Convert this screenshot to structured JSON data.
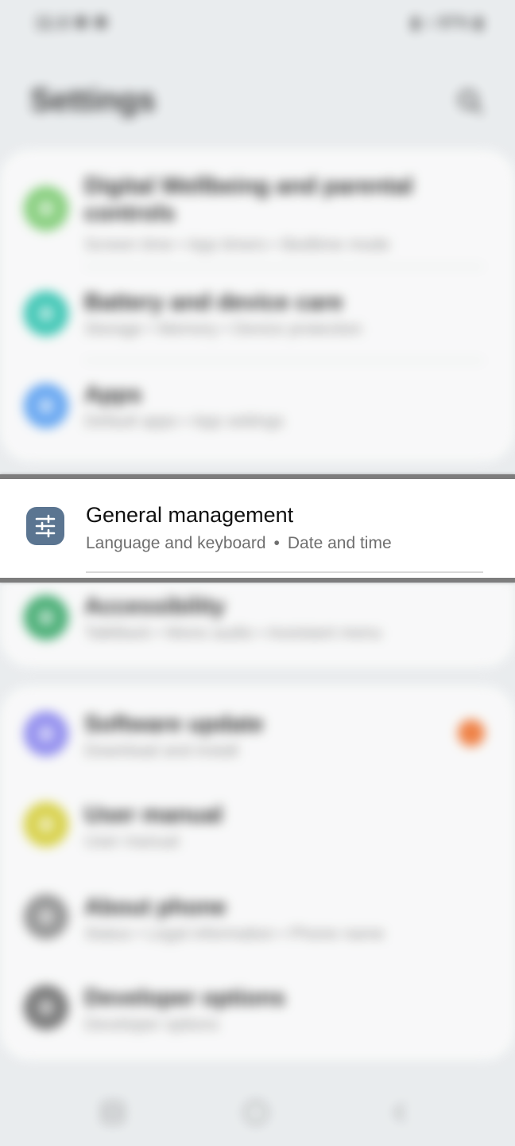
{
  "status": {
    "time": "11:0 ✱ ✱",
    "right": "▮ ◖ 97% ▮"
  },
  "header": {
    "title": "Settings"
  },
  "settings_items": [
    {
      "title": "Digital Wellbeing and parental",
      "title2": "controls",
      "subtitle": "Screen time • App timers • Bedtime mode",
      "color": "#7dcc72"
    },
    {
      "title": "Battery and device care",
      "subtitle": "Storage • Memory • Device protection",
      "color": "#2fc3b0"
    },
    {
      "title": "Apps",
      "subtitle": "Default apps • App settings",
      "color": "#5aa0f2"
    },
    {
      "title": "Accessibility",
      "subtitle": "TalkBack • Mono audio • Assistant menu",
      "color": "#3aa86a"
    },
    {
      "title": "Software update",
      "subtitle": "Download and install",
      "color": "#8a86ef"
    },
    {
      "title": "User manual",
      "subtitle": "User manual",
      "color": "#d6cf3a"
    },
    {
      "title": "About phone",
      "subtitle": "Status • Legal information • Phone name",
      "color": "#8f8f8f"
    },
    {
      "title": "Developer options",
      "subtitle": "Developer options",
      "color": "#6f6f6f"
    }
  ],
  "highlighted": {
    "title": "General management",
    "subtitle_parts": [
      "Language and keyboard",
      "Date and time"
    ],
    "separator": "•",
    "icon": "sliders-icon",
    "icon_color": "#5b7591"
  },
  "colors": {
    "background": "#e9ecee",
    "card": "#fafafa",
    "badge": "#f07a3a"
  }
}
